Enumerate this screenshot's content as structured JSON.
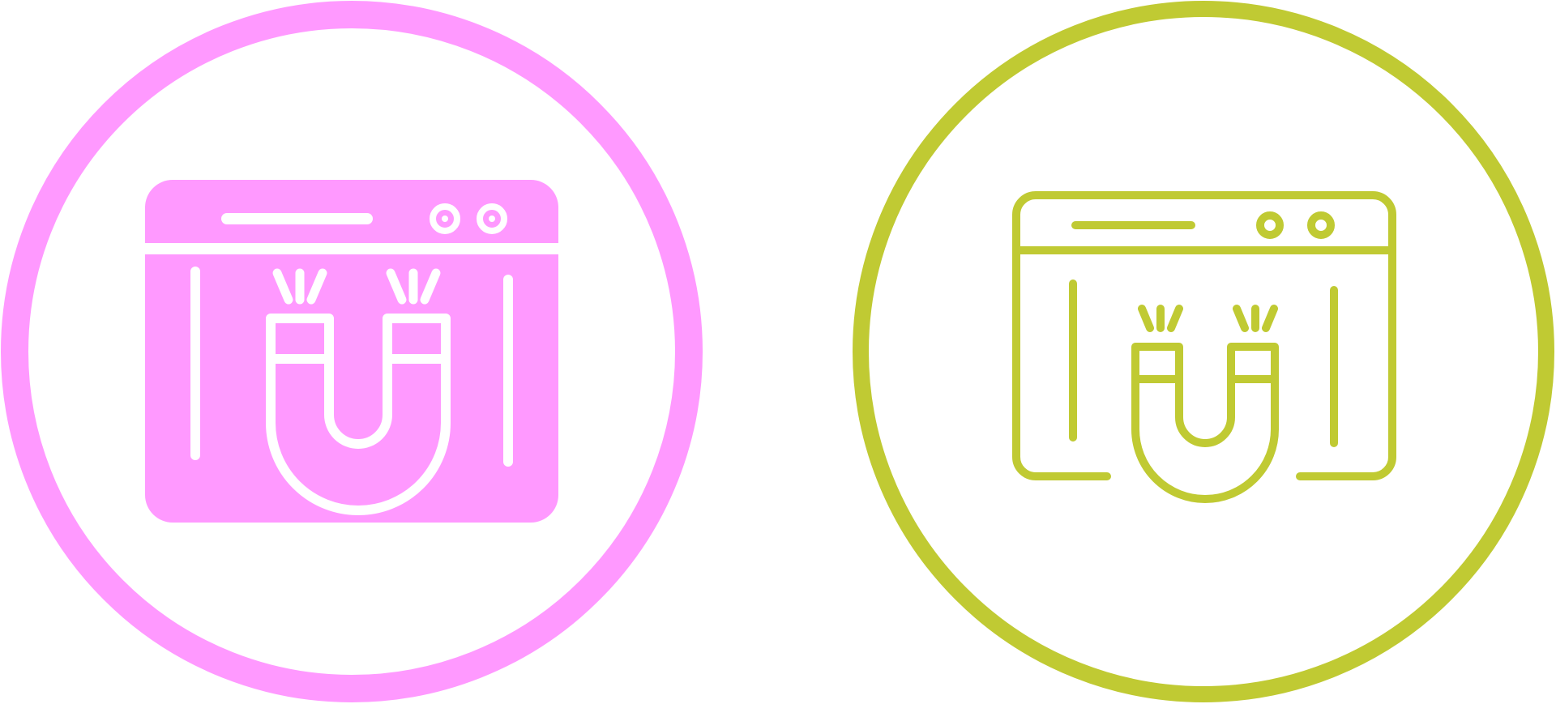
{
  "icons": [
    {
      "name": "magnet-browser-glyph-icon",
      "style": "glyph",
      "ring_color": "#FF99FF",
      "fill_color": "#FF99FF",
      "line_color": "#FFFFFF"
    },
    {
      "name": "magnet-browser-outline-icon",
      "style": "outline",
      "ring_color": "#C0CA33",
      "fill_color": "none",
      "line_color": "#C0CA33"
    }
  ]
}
